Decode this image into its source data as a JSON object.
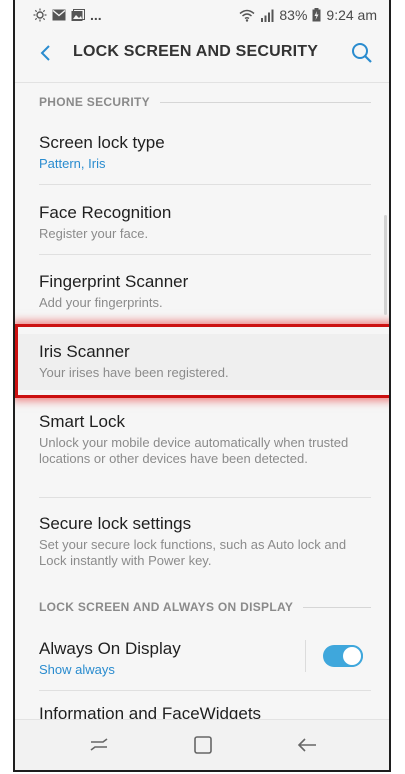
{
  "status_bar": {
    "battery": "83%",
    "time": "9:24 am",
    "dots": "..."
  },
  "app_bar": {
    "title": "LOCK SCREEN AND SECURITY"
  },
  "sections": {
    "phone_security": "PHONE SECURITY",
    "lock_screen": "LOCK SCREEN AND ALWAYS ON DISPLAY"
  },
  "items": [
    {
      "title": "Screen lock type",
      "subtitle": "Pattern, Iris"
    },
    {
      "title": "Face Recognition",
      "subtitle": "Register your face."
    },
    {
      "title": "Fingerprint Scanner",
      "subtitle": "Add your fingerprints."
    },
    {
      "title": "Iris Scanner",
      "subtitle": "Your irises have been registered."
    },
    {
      "title": "Smart Lock",
      "subtitle": "Unlock your mobile device automatically when trusted locations or other devices have been detected."
    },
    {
      "title": "Secure lock settings",
      "subtitle": "Set your secure lock functions, such as Auto lock and Lock instantly with Power key."
    },
    {
      "title": "Always On Display",
      "subtitle": "Show always",
      "toggle_on": true
    },
    {
      "title": "Information and FaceWidgets",
      "subtitle": ""
    }
  ],
  "colors": {
    "accent": "#2a8ccf",
    "highlight": "#cc1111",
    "toggle": "#3fa7dc"
  },
  "icons": {
    "back": "chevron-left-icon",
    "search": "search-icon",
    "nav_recents": "recents-icon",
    "nav_home": "home-icon",
    "nav_back": "back-arrow-icon"
  }
}
